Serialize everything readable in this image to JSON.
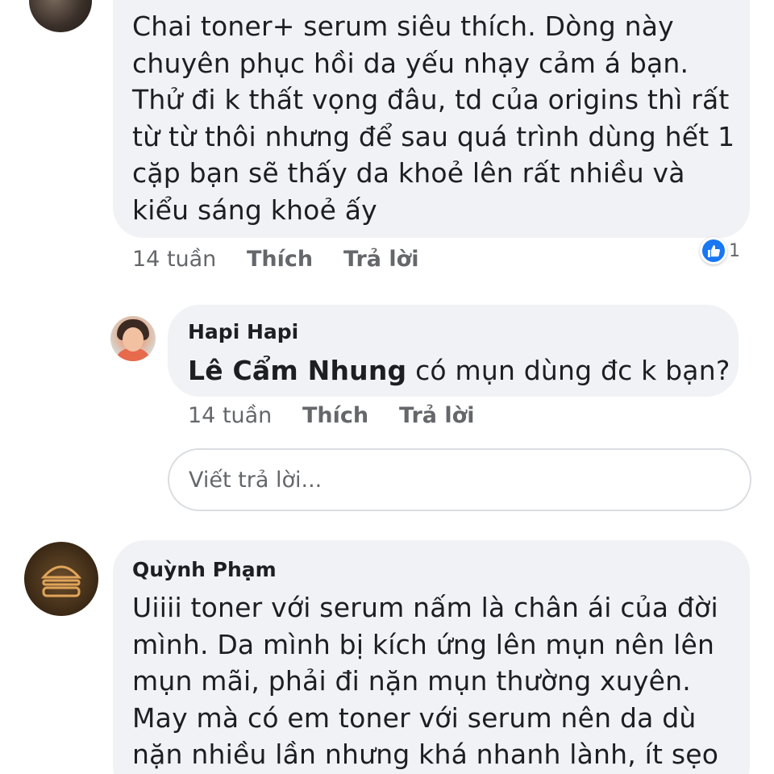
{
  "comments": [
    {
      "author": "",
      "text_lines": [
        "Chai toner+ serum siêu thích. Dòng này",
        "chuyên phục hồi da yếu nhạy cảm á bạn.",
        "Thử đi k thất vọng đâu, td của origins thì rất",
        "từ từ thôi nhưng để sau quá trình dùng hết 1",
        "cặp bạn sẽ thấy da khoẻ lên rất nhiều và",
        "kiểu sáng khoẻ ấy"
      ],
      "time": "14 tuần",
      "like_label": "Thích",
      "reply_label": "Trả lời",
      "reaction_count": "1",
      "reaction_icon": "like-icon"
    }
  ],
  "reply": {
    "author": "Hapi Hapi",
    "mention": "Lê Cẩm Nhung",
    "text": " có mụn dùng đc k bạn?",
    "time": "14 tuần",
    "like_label": "Thích",
    "reply_label": "Trả lời"
  },
  "reply_input": {
    "placeholder": "Viết trả lời..."
  },
  "comment2": {
    "author": "Quỳnh Phạm",
    "text_lines": [
      "Uiiii toner với serum nấm là chân ái của đời",
      "mình. Da mình bị kích ứng lên mụn nên lên",
      "mụn mãi, phải đi nặn mụn thường xuyên.",
      "May mà có em toner với serum nên da dù",
      "nặn nhiều lần nhưng khá nhanh lành, ít sẹo"
    ]
  },
  "colors": {
    "bubble": "#f0f2f5",
    "meta_text": "#65676b",
    "like_blue": "#1877f2"
  }
}
